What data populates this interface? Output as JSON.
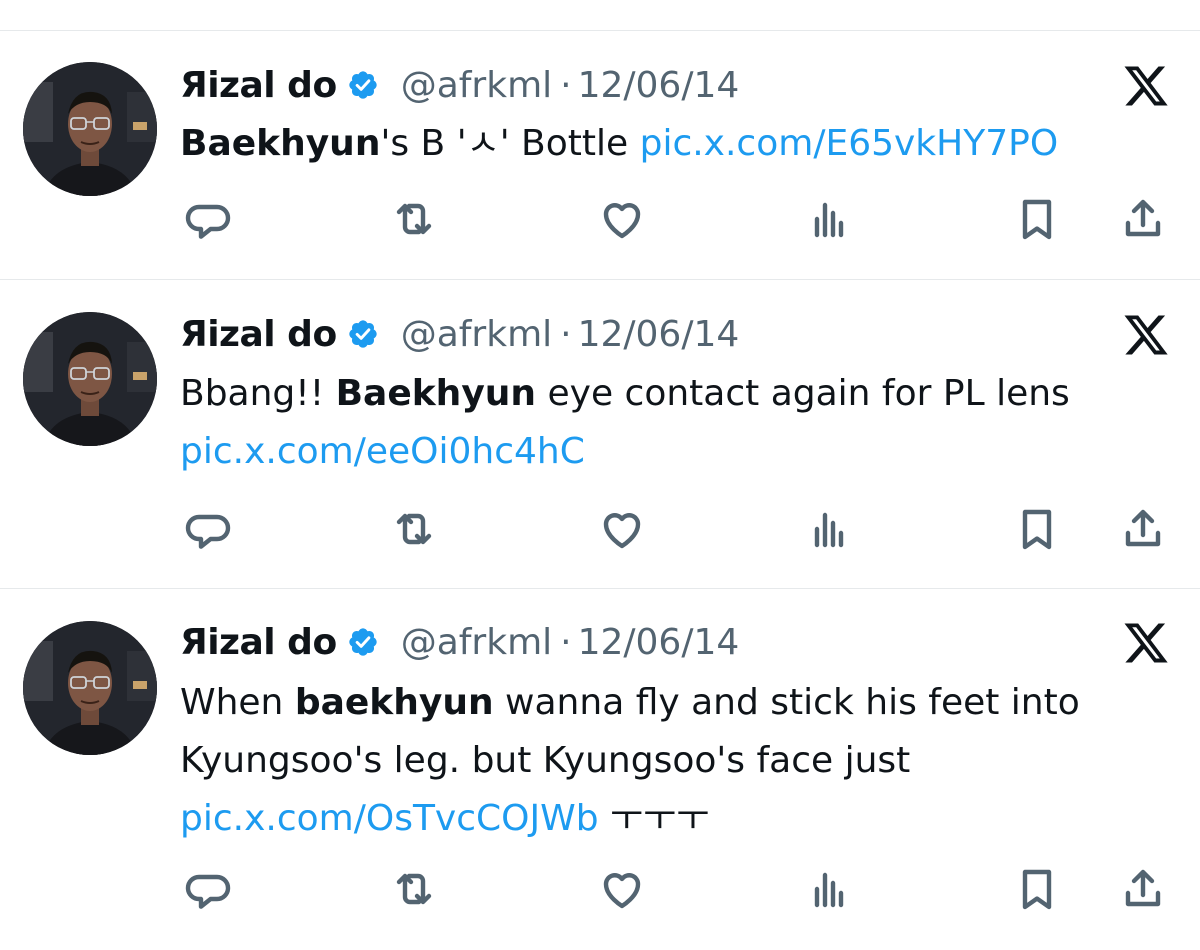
{
  "author": {
    "name": "Яizal do",
    "handle": "@afrkml",
    "separator": "·"
  },
  "icons": {
    "verified": "verified-badge-icon",
    "platform": "x-logo-icon",
    "reply": "reply-icon",
    "retweet": "retweet-icon",
    "like": "like-icon",
    "views": "views-icon",
    "bookmark": "bookmark-icon",
    "share": "share-icon"
  },
  "colors": {
    "link": "#1d9bf0",
    "verified": "#1d9bf0",
    "secondary_text": "#536471"
  },
  "tweets": [
    {
      "date": "12/06/14",
      "lines": [
        {
          "bold": "Baekhyun",
          "text": "'s B 'ㅅ' Bottle ",
          "link": "pic.x.com/E65vkHY7PO"
        }
      ]
    },
    {
      "date": "12/06/14",
      "lines": [
        {
          "pre": "Bbang!! ",
          "bold": "Baekhyun",
          "text": " eye contact again for PL lens"
        },
        {
          "link": "pic.x.com/eeOi0hc4hC"
        }
      ]
    },
    {
      "date": "12/06/14",
      "lines": [
        {
          "pre": "When ",
          "bold": "baekhyun",
          "text": " wanna fly and stick his feet into"
        },
        {
          "text": "Kyungsoo's leg. but Kyungsoo's face just"
        },
        {
          "link": "pic.x.com/OsTvcCOJWb",
          "post": " ㅜㅜㅜ"
        }
      ]
    }
  ]
}
